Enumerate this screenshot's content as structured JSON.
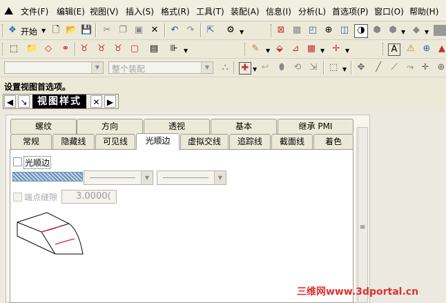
{
  "menubar": {
    "items": [
      {
        "label": "文件(F)"
      },
      {
        "label": "编辑(E)"
      },
      {
        "label": "视图(V)"
      },
      {
        "label": "插入(S)"
      },
      {
        "label": "格式(R)"
      },
      {
        "label": "工具(T)"
      },
      {
        "label": "装配(A)"
      },
      {
        "label": "信息(I)"
      },
      {
        "label": "分析(L)"
      },
      {
        "label": "首选项(P)"
      },
      {
        "label": "窗口(O)"
      },
      {
        "label": "帮助(H)"
      }
    ]
  },
  "toolbar1": {
    "start_label": "开始"
  },
  "toolbar3": {
    "assembly_combo_text": "整个装配",
    "filter_combo_text": ""
  },
  "prompt": {
    "text": "设置视图首选项。"
  },
  "dialog": {
    "title": "视图样式",
    "tabs_row1": [
      "螺纹",
      "方向",
      "透视",
      "基本",
      "继承 PMI"
    ],
    "tabs_row2": [
      "常规",
      "隐藏线",
      "可见线",
      "光顺边",
      "虚拟交线",
      "追踪线",
      "截面线",
      "着色"
    ],
    "active_tab": "光顺边",
    "smooth_edge_label": "光顺边",
    "smooth_edge_checked": false,
    "endpoint_gap_label": "端点缝隙",
    "endpoint_gap_value": "3.0000("
  },
  "watermark": {
    "text": "三维网www.3dportal.cn"
  },
  "colors": {
    "accent_red": "#e03030",
    "title_bg": "#000000"
  }
}
